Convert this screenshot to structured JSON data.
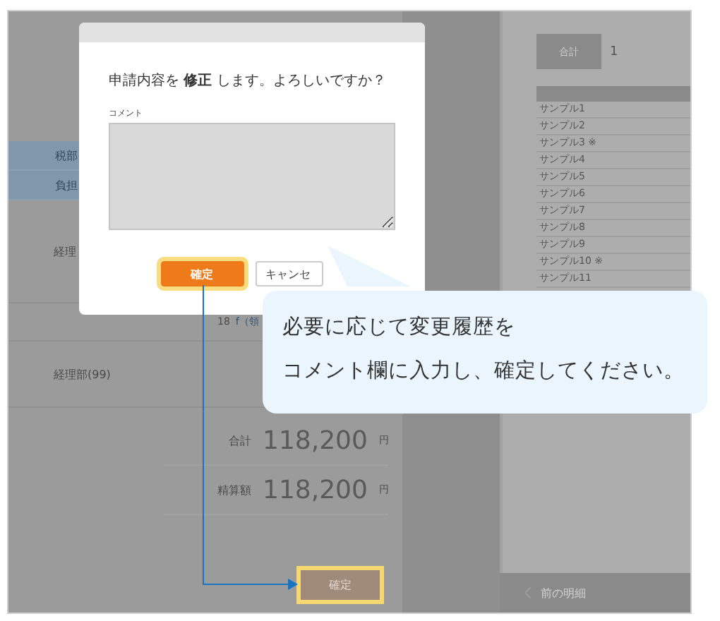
{
  "background": {
    "table_headers": [
      "税部",
      "負担"
    ],
    "rows": [
      {
        "label": "経理"
      },
      {
        "label": "",
        "number": "18",
        "link": "f（領"
      },
      {
        "label": "経理部(99)"
      }
    ],
    "totals": [
      {
        "label": "合計",
        "amount": "118,200",
        "unit": "円"
      },
      {
        "label": "精算額",
        "amount": "118,200",
        "unit": "円"
      }
    ],
    "confirm_button": {
      "label": "確定",
      "highlighted": true
    },
    "right_panel": {
      "total_label": "合計",
      "total_value": "1",
      "list": [
        "サンプル1",
        "サンプル2",
        "サンプル3 ※",
        "サンプル4",
        "サンプル5",
        "サンプル6",
        "サンプル7",
        "サンプル8",
        "サンプル9",
        "サンプル10 ※",
        "サンプル11"
      ]
    },
    "prev_link": "前の明細"
  },
  "dialog": {
    "message": "申請内容を **修正** します。よろしいですか？",
    "comment_label": "コメント",
    "buttons": [
      {
        "label": "確定",
        "kind": "primary",
        "highlighted": true
      },
      {
        "label": "キャンセ",
        "kind": "secondary",
        "highlighted": false
      }
    ]
  },
  "callout": {
    "lines": [
      "必要に応じて変更履歴を",
      "コメント欄に入力し、確定してください。"
    ]
  }
}
